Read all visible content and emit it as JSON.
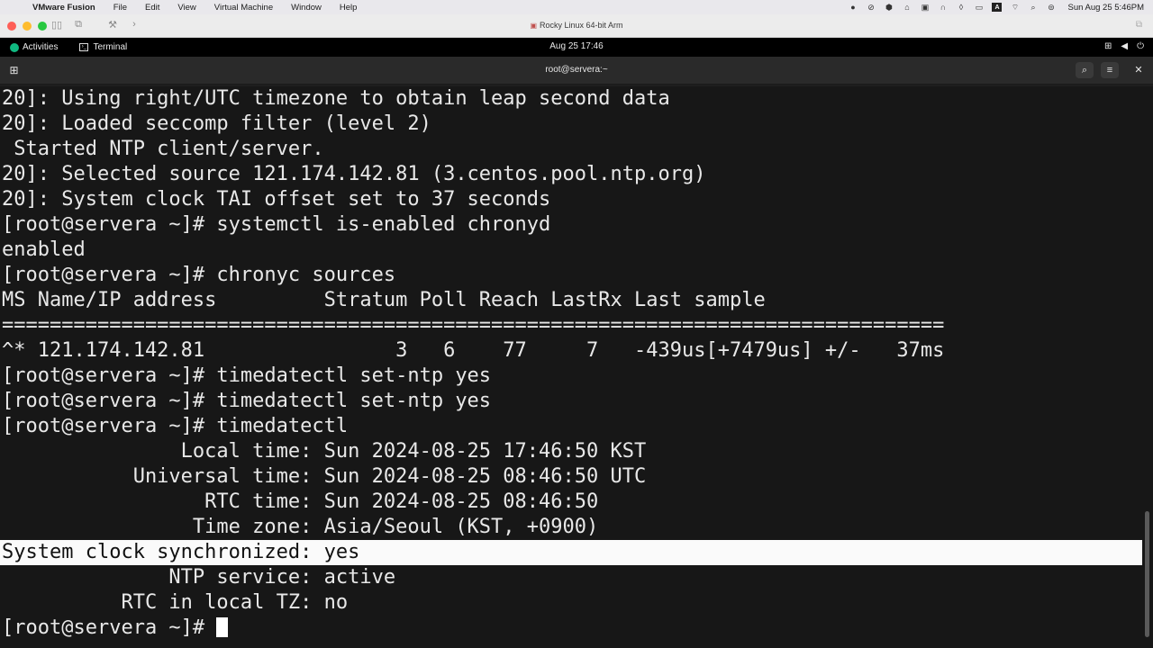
{
  "mac_menubar": {
    "app_name": "VMware Fusion",
    "menus": [
      "File",
      "Edit",
      "View",
      "Virtual Machine",
      "Window",
      "Help"
    ],
    "clock": "Sun Aug 25  5:46PM",
    "status_icons": [
      "record-icon",
      "slash-icon",
      "vpn-icon",
      "network-icon",
      "screen-icon",
      "headphones-icon",
      "shield-icon",
      "message-icon",
      "input-icon",
      "wifi-icon",
      "search-icon",
      "control-center-icon"
    ]
  },
  "vm_window": {
    "title": "Rocky Linux 64-bit Arm"
  },
  "gnome": {
    "activities": "Activities",
    "app": "Terminal",
    "datetime": "Aug 25  17:46"
  },
  "terminal": {
    "title": "root@servera:~",
    "lines": [
      "20]: Using right/UTC timezone to obtain leap second data",
      "20]: Loaded seccomp filter (level 2)",
      " Started NTP client/server.",
      "20]: Selected source 121.174.142.81 (3.centos.pool.ntp.org)",
      "20]: System clock TAI offset set to 37 seconds",
      "[root@servera ~]# systemctl is-enabled chronyd",
      "enabled",
      "[root@servera ~]# chronyc sources",
      "MS Name/IP address         Stratum Poll Reach LastRx Last sample",
      "===============================================================================",
      "^* 121.174.142.81                3   6    77     7   -439us[+7479us] +/-   37ms",
      "[root@servera ~]# timedatectl set-ntp yes",
      "[root@servera ~]# timedatectl set-ntp yes",
      "[root@servera ~]# timedatectl",
      "               Local time: Sun 2024-08-25 17:46:50 KST",
      "           Universal time: Sun 2024-08-25 08:46:50 UTC",
      "                 RTC time: Sun 2024-08-25 08:46:50",
      "                Time zone: Asia/Seoul (KST, +0900)",
      "System clock synchronized: yes",
      "              NTP service: active",
      "          RTC in local TZ: no",
      "[root@servera ~]# "
    ]
  }
}
